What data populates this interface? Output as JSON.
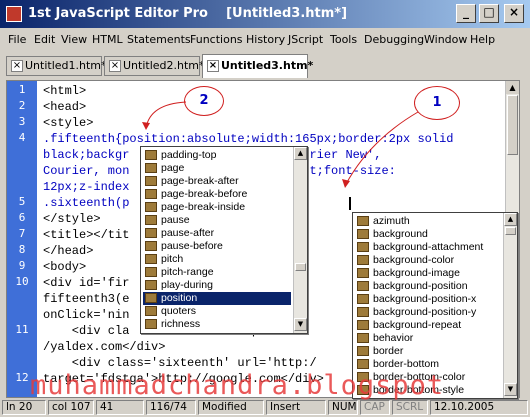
{
  "window": {
    "app_name": "1st JavaScript Editor Pro",
    "document_title": "[Untitled3.htm*]",
    "controls": {
      "minimize": "_",
      "maximize": "□",
      "close": "×"
    }
  },
  "menu": [
    "File",
    "Edit",
    "View",
    "HTML",
    "Statements",
    "Functions",
    "History",
    "JScript",
    "Tools",
    "Debugging",
    "Window",
    "Help"
  ],
  "tabs": [
    {
      "label": "Untitled1.htm*",
      "active": false
    },
    {
      "label": "Untitled2.htm*",
      "active": false
    },
    {
      "label": "Untitled3.htm*",
      "active": true
    }
  ],
  "editor": {
    "line_numbers": [
      "1",
      "2",
      "3",
      "4",
      "5",
      "6",
      "7",
      "8",
      "9",
      "10",
      "11",
      "12"
    ],
    "lines": [
      "<html>",
      "<head>",
      "<style>",
      ".fifteenth{position:absolute;width:165px;border:2px solid",
      "black;backgr              family:'Courier New',",
      "Courier, mon              rsor:default;font-size:",
      "12px;z-index              ; )",
      ".sixteenth(p                      )",
      "</style>",
      "<title></tit",
      "</head>",
      "<body>",
      "<div id='fir              ' onMo",
      "fifteenth3(e              ighteen",
      "onClick='nin              lay:no",
      "    <div cla              http:/",
      "/yaldex.com</div>",
      "    <div class='sixteenth' url='http:/",
      "target='fdstga'>http://google.com</div>",
      "    <div class='sixteenth' url='http:/"
    ]
  },
  "popup_left": {
    "items": [
      "padding-top",
      "page",
      "page-break-after",
      "page-break-before",
      "page-break-inside",
      "pause",
      "pause-after",
      "pause-before",
      "pitch",
      "pitch-range",
      "play-during",
      "position",
      "quoters",
      "richness"
    ],
    "selected": "position"
  },
  "popup_right": {
    "items": [
      "azimuth",
      "background",
      "background-attachment",
      "background-color",
      "background-image",
      "background-position",
      "background-position-x",
      "background-position-y",
      "background-repeat",
      "behavior",
      "border",
      "border-bottom",
      "border-bottom-color",
      "border-bottom-style"
    ]
  },
  "callouts": {
    "one": "1",
    "two": "2"
  },
  "statusbar": {
    "ln": "ln 20",
    "col": "col 107",
    "num": "41",
    "pos": "116/74",
    "modified": "Modified",
    "insert": "Insert",
    "num_lock": "NUM",
    "caps": "CAP",
    "scroll": "SCRL",
    "date": "12.10.2005"
  },
  "watermark": "muhammadchandra.blogspot"
}
